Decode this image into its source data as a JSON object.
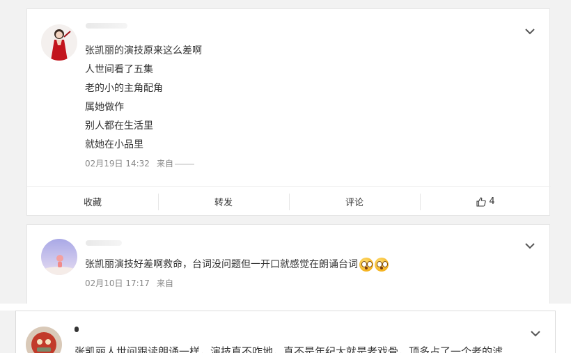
{
  "posts": [
    {
      "lines": [
        "张凯丽的演技原来这么差啊",
        "人世间看了五集",
        "老的小的主角配角",
        "属她做作",
        "别人都在生活里",
        "就她在小品里"
      ],
      "date": "02月19日 14:32",
      "source": "来自",
      "actions": {
        "favorite": "收藏",
        "repost": "转发",
        "comment": "评论",
        "like_count": "4"
      }
    },
    {
      "text": "张凯丽演技好差啊救命，台词没问题但一开口就感觉在朗诵台词",
      "emojis": [
        "astonished-emoji",
        "astonished-emoji"
      ],
      "date": "02月10日 17:17",
      "source": "来自"
    },
    {
      "text": "张凯丽人世间跟读朗诵一样，演技真不咋地，真不是年纪大就是老戏骨，顶多占了一个老的滤"
    }
  ],
  "colors": {
    "background": "#f2f2f2",
    "card": "#ffffff",
    "text": "#333333",
    "meta": "#888888"
  }
}
